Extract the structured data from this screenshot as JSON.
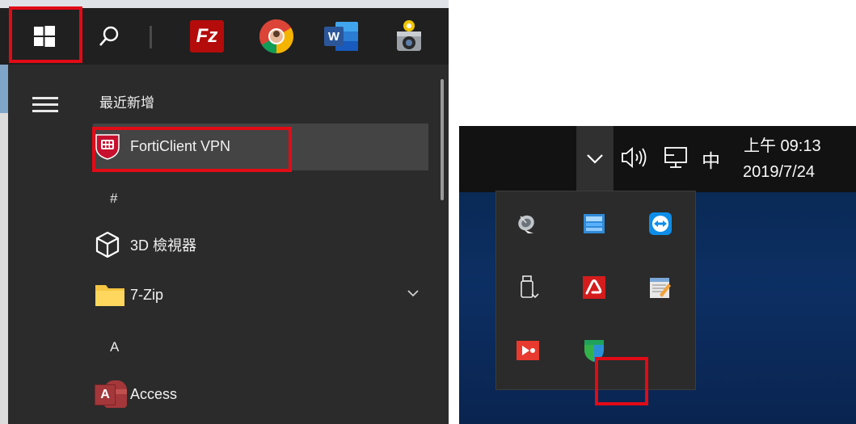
{
  "start_menu": {
    "taskbar": {
      "start_icon": "windows-logo-icon",
      "search_icon": "search-icon",
      "pinned": [
        {
          "name": "filezilla",
          "label": "Fz",
          "color": "#b40b0b"
        },
        {
          "name": "chrome",
          "icon": "chrome-icon"
        },
        {
          "name": "word",
          "label": "W",
          "color": "#2b579a"
        },
        {
          "name": "camera",
          "icon": "camera-icon"
        }
      ]
    },
    "section_recent": "最近新增",
    "apps": [
      {
        "name": "FortiClient VPN",
        "icon": "forticlient-icon"
      },
      {
        "letter": "#"
      },
      {
        "name": "3D 檢視器",
        "icon": "cube-icon"
      },
      {
        "name": "7-Zip",
        "icon": "folder-icon"
      },
      {
        "letter": "A"
      },
      {
        "name": "Access",
        "icon": "access-icon"
      }
    ],
    "access_icon_label": "A",
    "highlight_color": "#e10b16"
  },
  "tray": {
    "ime": "中",
    "clock_time": "上午 09:13",
    "clock_date": "2019/7/24",
    "overflow_icons": [
      "satellite-dish-icon",
      "monitor-tool-icon",
      "teamviewer-icon",
      "usb-drive-icon",
      "avira-icon",
      "notepad-icon",
      "red-arrow-app-icon",
      "shield-app-icon"
    ]
  }
}
